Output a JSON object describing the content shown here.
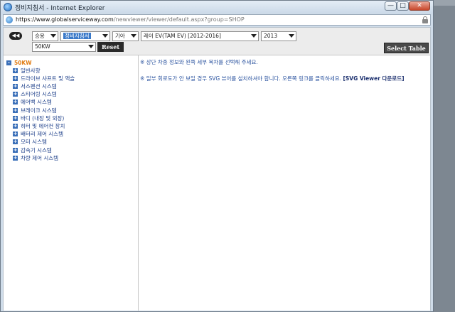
{
  "window": {
    "title": "정비지침서 - Internet Explorer",
    "min_glyph": "—",
    "max_glyph": "□",
    "close_glyph": "✕"
  },
  "address": {
    "scheme": "https://",
    "host": "www.globalserviceway.com",
    "path": "/newviewer/viewer/default.aspx?group=SHOP"
  },
  "toolbar": {
    "back_glyph": "◀◀",
    "selects": [
      "승용",
      "정비지침서",
      "기아",
      "레이 EV(TAM EV) [2012-2016]",
      "2013",
      "50KW"
    ],
    "reset_label": "Reset",
    "select_table_label": "Select Table"
  },
  "tree": {
    "root": {
      "toggle": "-",
      "label": "50KW"
    },
    "items": [
      {
        "toggle": "+",
        "label": "일반사항"
      },
      {
        "toggle": "+",
        "label": "드라이브 샤프트 및 액슬"
      },
      {
        "toggle": "+",
        "label": "서스펜션 시스템"
      },
      {
        "toggle": "+",
        "label": "스티어링 시스템"
      },
      {
        "toggle": "+",
        "label": "에어백 시스템"
      },
      {
        "toggle": "+",
        "label": "브레이크 시스템"
      },
      {
        "toggle": "+",
        "label": "바디 (내장 및 외장)"
      },
      {
        "toggle": "+",
        "label": "히터 및 에어컨 장치"
      },
      {
        "toggle": "+",
        "label": "배터리 제어 시스템"
      },
      {
        "toggle": "+",
        "label": "모터 시스템"
      },
      {
        "toggle": "+",
        "label": "감속기 시스템"
      },
      {
        "toggle": "+",
        "label": "차량 제어 시스템"
      }
    ]
  },
  "messages": {
    "line1": "※ 상단 차종 정보와 왼쪽 세부 목차를 선택해 주세요.",
    "line2": "※ 일부 회로도가 안 보일 경우 SVG 뷰어를 설치하셔야 합니다. 오른쪽 링크를 클릭하세요.",
    "line2_link": "[SVG Viewer 다운로드]"
  }
}
